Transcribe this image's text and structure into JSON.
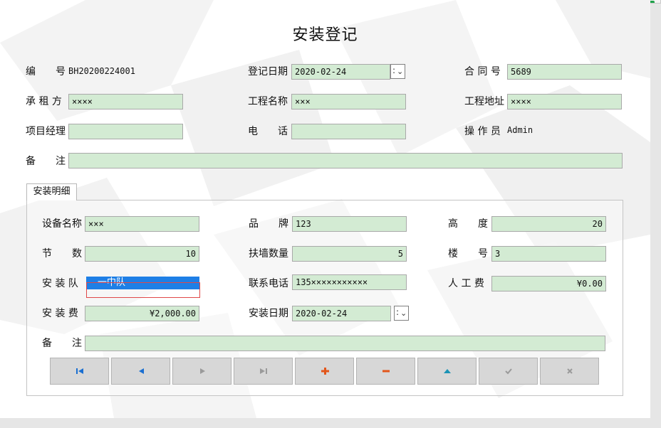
{
  "form": {
    "title": "安装登记",
    "serial_label": "编　　号",
    "serial_value": "BH20200224001",
    "reg_date_label": "登记日期",
    "reg_date_value": "2020-02-24",
    "contract_label": "合 同 号",
    "contract_value": "5689",
    "tenant_label": "承 租 方",
    "tenant_value": "××××",
    "project_label": "工程名称",
    "project_value": "×××",
    "site_label": "工程地址",
    "site_value": "××××",
    "manager_label": "项目经理",
    "manager_value": "",
    "phone_label": "电　　话",
    "phone_value": "",
    "operator_label": "操 作 员",
    "operator_value": "Admin",
    "remark_label": "备　　注",
    "remark_value": ""
  },
  "detail": {
    "tab_label": "安装明细",
    "device_label": "设备名称",
    "device_value": "×××",
    "brand_label": "品　　牌",
    "brand_value": "123",
    "height_label": "高　　度",
    "height_value": "20",
    "section_label": "节　　数",
    "section_value": "10",
    "wall_label": "扶墙数量",
    "wall_value": "5",
    "building_label": "楼　　号",
    "building_value": "3",
    "team_label": "安 装 队",
    "team_value": "一中队",
    "contact_label": "联系电话",
    "contact_value": "135×××××××××××",
    "labor_label": "人 工 费",
    "labor_value": "¥0.00",
    "fee_label": "安 装 费",
    "fee_value": "¥2,000.00",
    "install_date_label": "安装日期",
    "install_date_value": "2020-02-24",
    "remark_label": "备　　注",
    "remark_value": ""
  },
  "navigator": {
    "buttons": [
      {
        "name": "first-record-button",
        "icon": "first-icon"
      },
      {
        "name": "prior-record-button",
        "icon": "prior-icon"
      },
      {
        "name": "next-record-button",
        "icon": "next-icon"
      },
      {
        "name": "last-record-button",
        "icon": "last-icon"
      },
      {
        "name": "insert-record-button",
        "icon": "plus-icon"
      },
      {
        "name": "delete-record-button",
        "icon": "minus-icon"
      },
      {
        "name": "edit-record-button",
        "icon": "up-arrow-icon"
      },
      {
        "name": "post-record-button",
        "icon": "check-icon"
      },
      {
        "name": "cancel-record-button",
        "icon": "cross-icon"
      }
    ]
  },
  "colors": {
    "field_bg": "#d3ebd3",
    "selection_blue": "#1e7fe6",
    "nav_blue": "#1a6fd1",
    "nav_orange": "#e2561b",
    "nav_teal": "#1b93b5",
    "disabled_gray": "#9a9a9a"
  }
}
